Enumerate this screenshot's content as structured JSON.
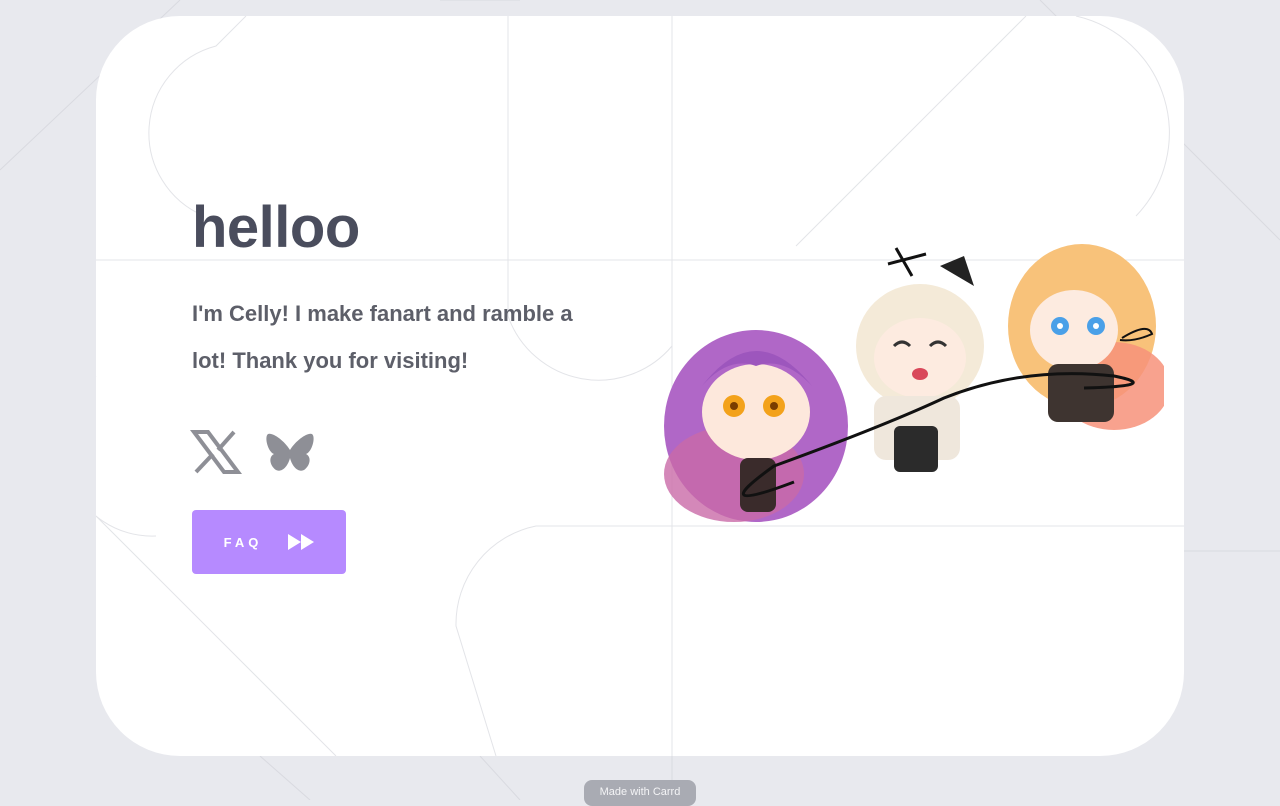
{
  "page": {
    "title": "helloo",
    "bio": "I'm Celly! I make fanart and ramble a lot! Thank you for visiting!"
  },
  "social": [
    {
      "name": "X",
      "icon": "x-logo-icon"
    },
    {
      "name": "Bluesky",
      "icon": "butterfly-icon"
    }
  ],
  "faq_button": {
    "label": "FAQ",
    "icon": "fast-forward-icon"
  },
  "footer": {
    "badge": "Made with Carrd"
  },
  "colors": {
    "background": "#e8e9ee",
    "card": "#ffffff",
    "title": "#4a4d5d",
    "text": "#5d5f69",
    "accent": "#b68aff",
    "icon": "#8e8f96"
  }
}
